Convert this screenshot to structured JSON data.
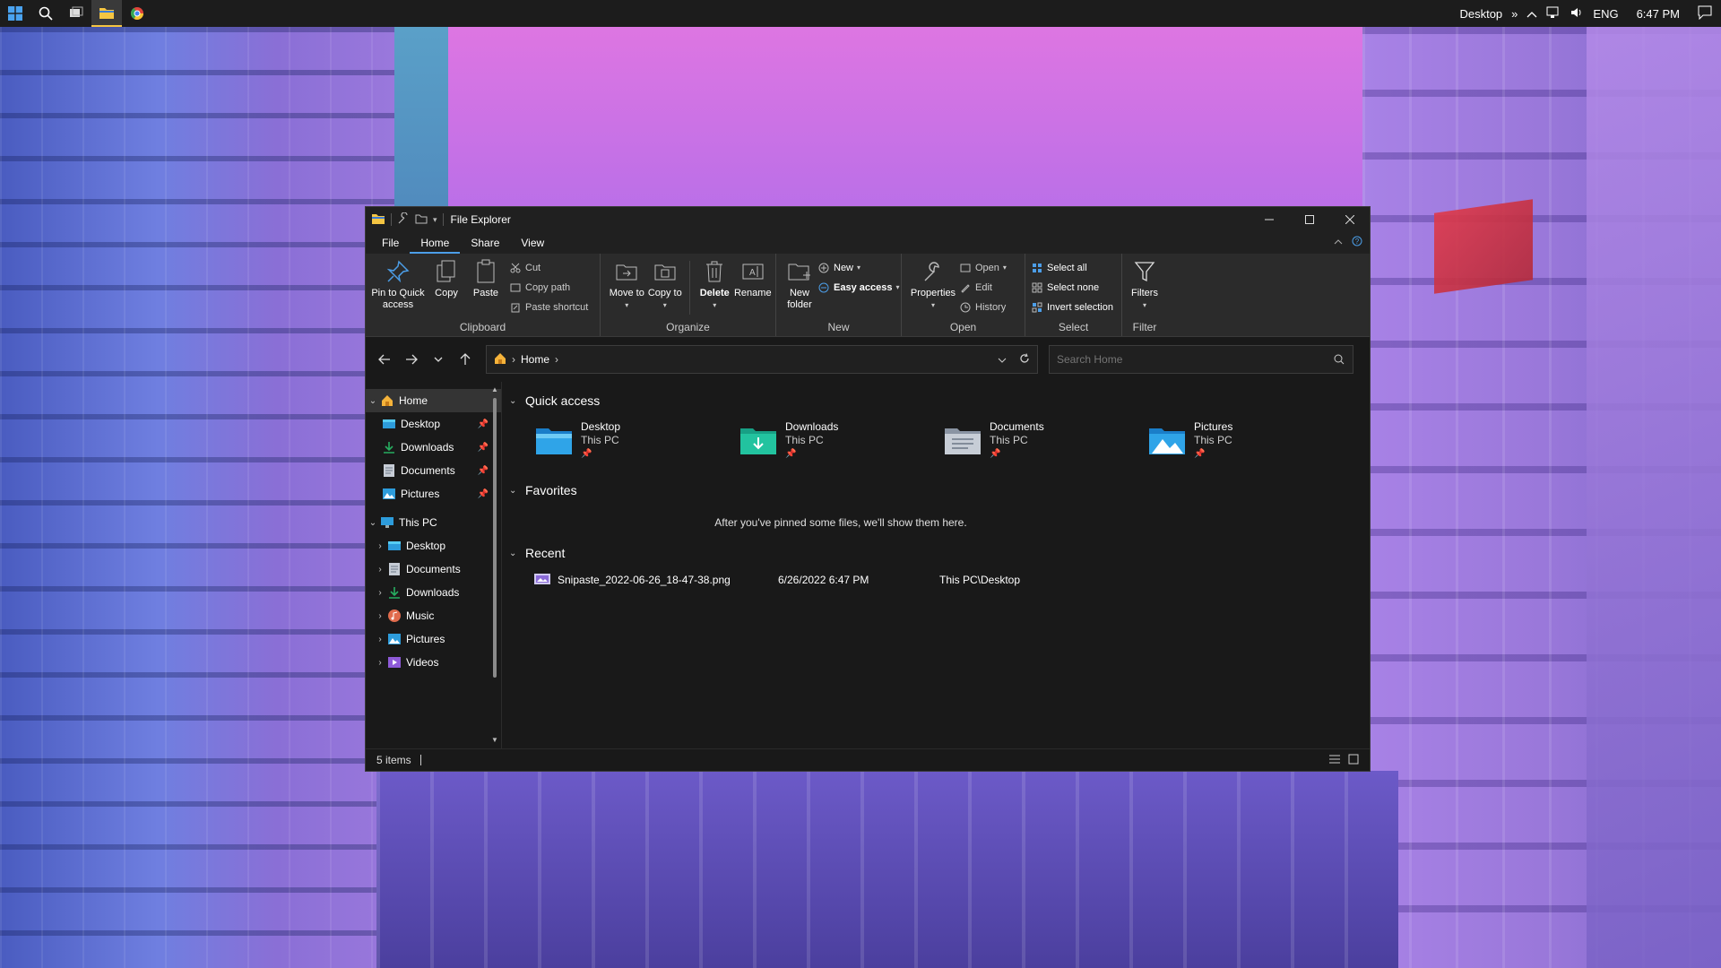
{
  "taskbar": {
    "desktop_label": "Desktop",
    "lang": "ENG",
    "time": "6:47 PM"
  },
  "window": {
    "title": "File Explorer"
  },
  "tabs": [
    "File",
    "Home",
    "Share",
    "View"
  ],
  "ribbon": {
    "clipboard": {
      "label": "Clipboard",
      "pin": "Pin to Quick access",
      "copy": "Copy",
      "paste": "Paste",
      "cut": "Cut",
      "copy_path": "Copy path",
      "paste_shortcut": "Paste shortcut"
    },
    "organize": {
      "label": "Organize",
      "move_to": "Move to",
      "copy_to": "Copy to",
      "delete": "Delete",
      "rename": "Rename"
    },
    "new": {
      "label": "New",
      "new_folder": "New folder",
      "new_item": "New",
      "easy_access": "Easy access"
    },
    "open": {
      "label": "Open",
      "properties": "Properties",
      "open": "Open",
      "edit": "Edit",
      "history": "History"
    },
    "select": {
      "label": "Select",
      "select_all": "Select all",
      "select_none": "Select none",
      "invert": "Invert selection"
    },
    "filter": {
      "label": "Filter",
      "filters": "Filters"
    }
  },
  "address": {
    "crumb": "Home",
    "search_placeholder": "Search Home"
  },
  "nav": {
    "home": "Home",
    "pinned": [
      "Desktop",
      "Downloads",
      "Documents",
      "Pictures"
    ],
    "this_pc": "This PC",
    "pc_items": [
      "Desktop",
      "Documents",
      "Downloads",
      "Music",
      "Pictures",
      "Videos"
    ]
  },
  "content": {
    "quick_access_title": "Quick access",
    "quick_access": [
      {
        "name": "Desktop",
        "sub": "This PC",
        "icon": "desktop-folder-icon"
      },
      {
        "name": "Downloads",
        "sub": "This PC",
        "icon": "downloads-folder-icon"
      },
      {
        "name": "Documents",
        "sub": "This PC",
        "icon": "documents-folder-icon"
      },
      {
        "name": "Pictures",
        "sub": "This PC",
        "icon": "pictures-folder-icon"
      }
    ],
    "favorites_title": "Favorites",
    "favorites_empty": "After you've pinned some files, we'll show them here.",
    "recent_title": "Recent",
    "recent": [
      {
        "name": "Snipaste_2022-06-26_18-47-38.png",
        "date": "6/26/2022 6:47 PM",
        "location": "This PC\\Desktop"
      }
    ]
  },
  "status": {
    "items": "5 items"
  },
  "colors": {
    "accent": "#4c9ee8",
    "window_bg": "#191919",
    "ribbon_bg": "#2b2b2b"
  }
}
